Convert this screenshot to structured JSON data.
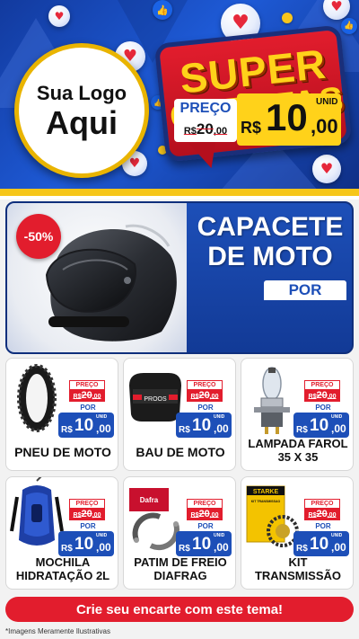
{
  "header": {
    "logo_line1": "Sua Logo",
    "logo_line2": "Aqui",
    "super_line1": "SUPER",
    "super_line2": "OFERTAS",
    "icons": [
      "heart-icon",
      "like-icon",
      "emoji-icon"
    ]
  },
  "featured": {
    "discount": "-50%",
    "title_line1": "CAPACETE",
    "title_line2": "DE MOTO",
    "preco_label": "PREÇO",
    "old_currency": "R$",
    "old_int": "20",
    "old_dec": ",00",
    "por_label": "POR",
    "unid_label": "UNID",
    "new_currency": "R$",
    "new_int": "10",
    "new_dec": ",00"
  },
  "products": [
    {
      "name_line1": "PNEU DE MOTO",
      "name_line2": "",
      "preco_label": "PREÇO",
      "old_currency": "R$",
      "old_int": "20",
      "old_dec": ",00",
      "por_label": "POR",
      "unid_label": "UNID",
      "new_currency": "R$",
      "new_int": "10",
      "new_dec": ",00"
    },
    {
      "name_line1": "BAU DE MOTO",
      "name_line2": "",
      "preco_label": "PREÇO",
      "old_currency": "R$",
      "old_int": "20",
      "old_dec": ",00",
      "por_label": "POR",
      "unid_label": "UNID",
      "new_currency": "R$",
      "new_int": "10",
      "new_dec": ",00",
      "image_text": "PROOS"
    },
    {
      "name_line1": "LAMPADA FAROL",
      "name_line2": "35 X 35",
      "preco_label": "PREÇO",
      "old_currency": "R$",
      "old_int": "20",
      "old_dec": ",00",
      "por_label": "POR",
      "unid_label": "UNID",
      "new_currency": "R$",
      "new_int": "10",
      "new_dec": ",00"
    },
    {
      "name_line1": "MOCHILA",
      "name_line2": "HIDRATAÇÃO 2L",
      "preco_label": "PREÇO",
      "old_currency": "R$",
      "old_int": "20",
      "old_dec": ",00",
      "por_label": "POR",
      "unid_label": "UNID",
      "new_currency": "R$",
      "new_int": "10",
      "new_dec": ",00"
    },
    {
      "name_line1": "PATIM DE FREIO",
      "name_line2": "DIAFRAG",
      "preco_label": "PREÇO",
      "old_currency": "R$",
      "old_int": "20",
      "old_dec": ",00",
      "por_label": "POR",
      "unid_label": "UNID",
      "new_currency": "R$",
      "new_int": "10",
      "new_dec": ",00",
      "image_text": "Dafra"
    },
    {
      "name_line1": "KIT",
      "name_line2": "TRANSMISSÃO",
      "preco_label": "PREÇO",
      "old_currency": "R$",
      "old_int": "20",
      "old_dec": ",00",
      "por_label": "POR",
      "unid_label": "UNID",
      "new_currency": "R$",
      "new_int": "10",
      "new_dec": ",00",
      "image_text": "STARKE",
      "image_subtext": "KIT TRANSMISSAO"
    }
  ],
  "footer": {
    "cta": "Crie seu encarte com este tema!",
    "disclaimer": "*Imagens Meramente Ilustrativas"
  },
  "colors": {
    "blue": "#1d4fb8",
    "red": "#e21d2d",
    "yellow": "#ffd21a",
    "gold_border": "#e9b400"
  }
}
